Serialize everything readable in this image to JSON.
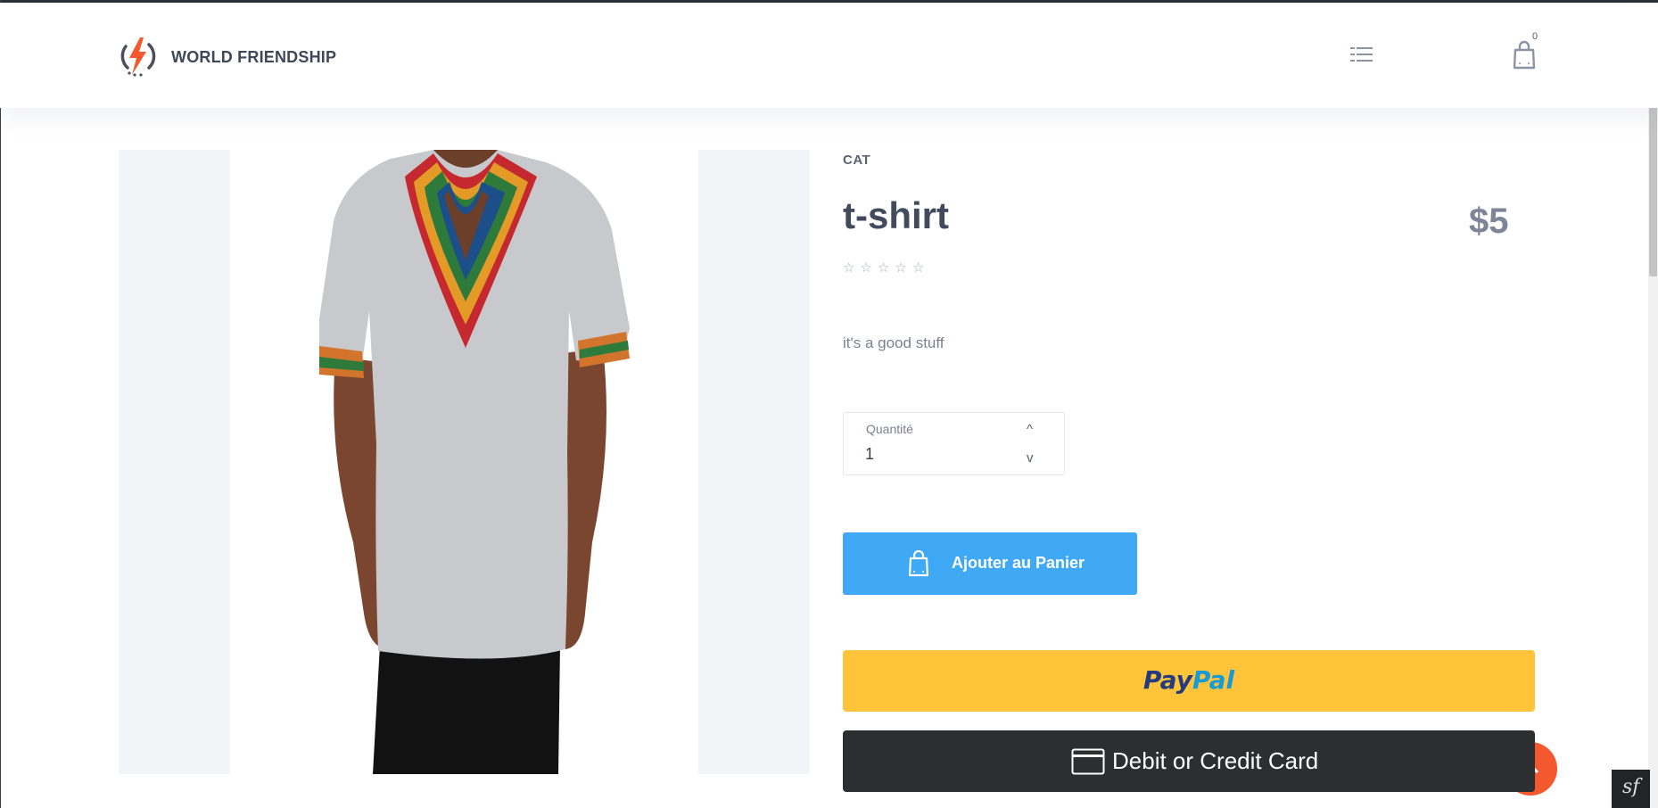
{
  "header": {
    "brand": "WORLD FRIENDSHIP",
    "logo_icon": "lightning-bolt-logo",
    "menu_icon": "menu-lines-icon",
    "cart_icon": "shopping-bag-icon",
    "cart_count": "0"
  },
  "product": {
    "category": "CAT",
    "title": "t-shirt",
    "price": "$5",
    "rating": {
      "value": 0,
      "max": 5,
      "stars": [
        "☆",
        "☆",
        "☆",
        "☆",
        "☆"
      ]
    },
    "description": "it's a good stuff",
    "image": "t-shirt-photo"
  },
  "quantity": {
    "label": "Quantité",
    "value": "1",
    "increment": "^",
    "decrement": "v"
  },
  "actions": {
    "add_to_cart": "Ajouter au Panier",
    "paypal_pay": "Pay",
    "paypal_pal": "Pal",
    "card": "Debit or Credit Card"
  },
  "colors": {
    "accent_blue": "#3fa9f5",
    "paypal_yellow": "#ffc439",
    "card_dark": "#2c2e2f",
    "fab_orange": "#f4582f",
    "logo_orange": "#f4582f"
  },
  "misc": {
    "scroll_up_icon": "arrow-up-icon",
    "symfony_badge": "sf"
  }
}
